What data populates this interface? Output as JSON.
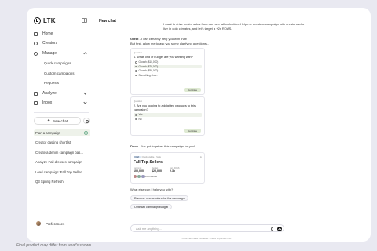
{
  "app": {
    "brand": "LTK"
  },
  "sidebar": {
    "nav": [
      {
        "label": "Home"
      },
      {
        "label": "Creators"
      },
      {
        "label": "Manage"
      }
    ],
    "manage_sub": [
      "Quick campaigns",
      "Custom campaigns",
      "Requests"
    ],
    "nav2": [
      {
        "label": "Analyze"
      },
      {
        "label": "Inbox"
      }
    ],
    "new_chat_label": "New chat",
    "history": [
      "Plan a campaign",
      "Creator casting shortlist",
      "Create a denim campaign bas...",
      "Analyze Fall dresses campaign",
      "Load campaign: Fall Top Seller...",
      "Q3 Spring Refresh"
    ],
    "preferences_label": "Preferences"
  },
  "chat": {
    "title": "New chat",
    "user_message": "I want to drive denim sales from our new fall collection. Help me create a campaign with creators who live in cold climates, and let's target a +2x ROAS.",
    "bot_intro_name": "Great",
    "bot_intro_text": " - I can certainly help you with that!",
    "bot_intro_line2": "But first, allow me to ask you some clarifying questions...",
    "q1": {
      "label": "Question",
      "text": "1. What kind of budget are you working with?",
      "options": [
        "Growth ($10,000)",
        "Growth ($20,000)",
        "Growth ($50,000)",
        "Something else..."
      ],
      "continue": "Continue"
    },
    "q2": {
      "label": "Question",
      "text": "2. Are you looking to add gifted products to this campaign?",
      "options": [
        "Yes",
        "No"
      ],
      "continue": "Continue"
    },
    "done_name": "Done",
    "done_text": " - I've put together this campaign for you!",
    "campaign": {
      "badge": "Draft",
      "subtitle": "Quick visible, Posts",
      "title": "Fall Top-Sellers",
      "stats": [
        {
          "k": "Est. impr.",
          "v": "100,000"
        },
        {
          "k": "Budget",
          "v": "$20,000"
        },
        {
          "k": "Est. ROAS",
          "v": "2.3x"
        }
      ],
      "creators_text": "20 creators"
    },
    "followup": "What else can I help you with?",
    "suggestions": [
      "Discover new creators for this campaign",
      "Optimize campaign budget"
    ],
    "input_placeholder": "Ask me anything...",
    "disclaimer": "LTK.ai can make mistakes. Check important info."
  },
  "footnote": "Final product may differ from what's shown."
}
